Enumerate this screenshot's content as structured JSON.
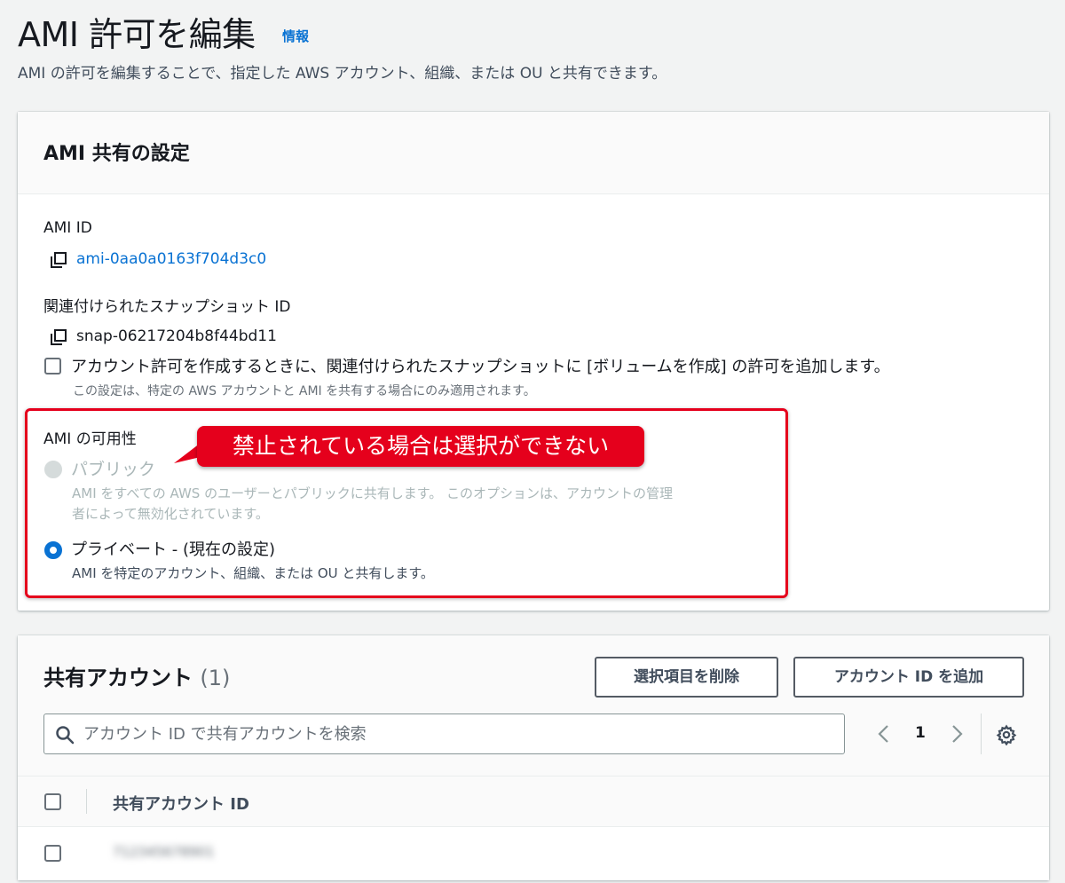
{
  "header": {
    "title": "AMI 許可を編集",
    "info_link": "情報",
    "description": "AMI の許可を編集することで、指定した AWS アカウント、組織、または OU と共有できます。"
  },
  "sharing_settings": {
    "title": "AMI 共有の設定",
    "ami_id_label": "AMI ID",
    "ami_id_value": "ami-0aa0a0163f704d3c0",
    "snapshot_label": "関連付けられたスナップショット ID",
    "snapshot_value": "snap-06217204b8f44bd11",
    "snapshot_checkbox_label": "アカウント許可を作成するときに、関連付けられたスナップショットに [ボリュームを作成] の許可を追加します。",
    "snapshot_checkbox_desc": "この設定は、特定の AWS アカウントと AMI を共有する場合にのみ適用されます。",
    "availability_label": "AMI の可用性",
    "public_label": "パブリック",
    "public_desc_line1": "AMI をすべての AWS のユーザーとパブリックに共有します。 このオプションは、アカウントの管理",
    "public_desc_line2": "者によって無効化されています。",
    "private_label": "プライベート - (現在の設定)",
    "private_desc": "AMI を特定のアカウント、組織、または OU と共有します。",
    "selected_option": "private"
  },
  "annotation": {
    "callout_text": "禁止されている場合は選択ができない",
    "color": "#e5001c"
  },
  "shared_accounts": {
    "title": "共有アカウント",
    "count": "(1)",
    "delete_button": "選択項目を削除",
    "add_button": "アカウント ID を追加",
    "search_placeholder": "アカウント ID で共有アカウントを検索",
    "current_page": "1",
    "column_header": "共有アカウント ID",
    "rows": [
      {
        "account_id": "712345678901"
      }
    ]
  },
  "colors": {
    "accent": "#0972d3",
    "background": "#f2f3f3",
    "disabled": "#aab7b8"
  }
}
